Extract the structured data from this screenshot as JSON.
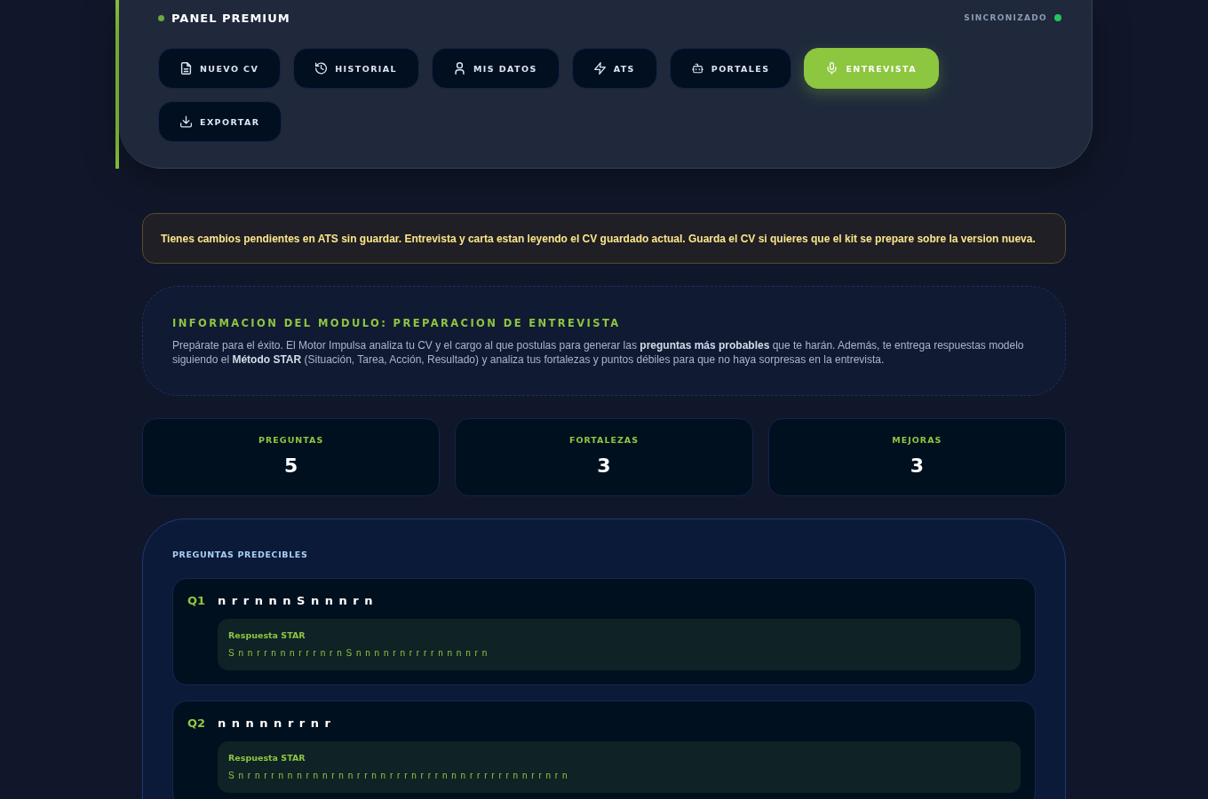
{
  "panel": {
    "title": "PANEL PREMIUM",
    "sync_status": "SINCRONIZADO",
    "nav_buttons": [
      {
        "label": "NUEVO CV",
        "selected": false
      },
      {
        "label": "HISTORIAL",
        "selected": false
      },
      {
        "label": "MIS DATOS",
        "selected": false
      },
      {
        "label": "ATS",
        "selected": false
      },
      {
        "label": "PORTALES",
        "selected": false
      },
      {
        "label": "ENTREVISTA",
        "selected": true
      },
      {
        "label": "EXPORTAR",
        "selected": false
      }
    ]
  },
  "alert": {
    "text": "Tienes cambios pendientes en ATS sin guardar. Entrevista y carta estan leyendo el CV guardado actual. Guarda el CV si quieres que el kit se prepare sobre la version nueva."
  },
  "module_info": {
    "title": "INFORMACION DEL MODULO: PREPARACION DE ENTREVISTA",
    "text": "Prepárate para el éxito. El Motor Impulsa analiza tu CV y el cargo al que postulas para generar las **preguntas más probables** que te harán. Además, te entrega respuestas modelo siguiendo el **Método STAR** (Situación, Tarea, Acción, Resultado) y analiza tus fortalezas y puntos débiles para que no haya sorpresas en la entrevista."
  },
  "stats": [
    {
      "label": "PREGUNTAS",
      "value": "5"
    },
    {
      "label": "FORTALEZAS",
      "value": "3"
    },
    {
      "label": "MEJORAS",
      "value": "3"
    }
  ],
  "questions_section": {
    "title": "PREGUNTAS PREDECIBLES",
    "questions": [
      {
        "number": "Q1",
        "text": "n r r n n n S n n n r n",
        "answer_label": "Respuesta STAR",
        "answer": "S n n r r n n n r r r n r n S n n n n r n r r r r n n n n r n"
      },
      {
        "number": "Q2",
        "text": "n n n n n r r n r",
        "answer_label": "Respuesta STAR",
        "answer": "S n r n r r n n n r n n r n n r r n n r r r n r r r n n n r r r r r r n n r r n r n"
      }
    ]
  }
}
